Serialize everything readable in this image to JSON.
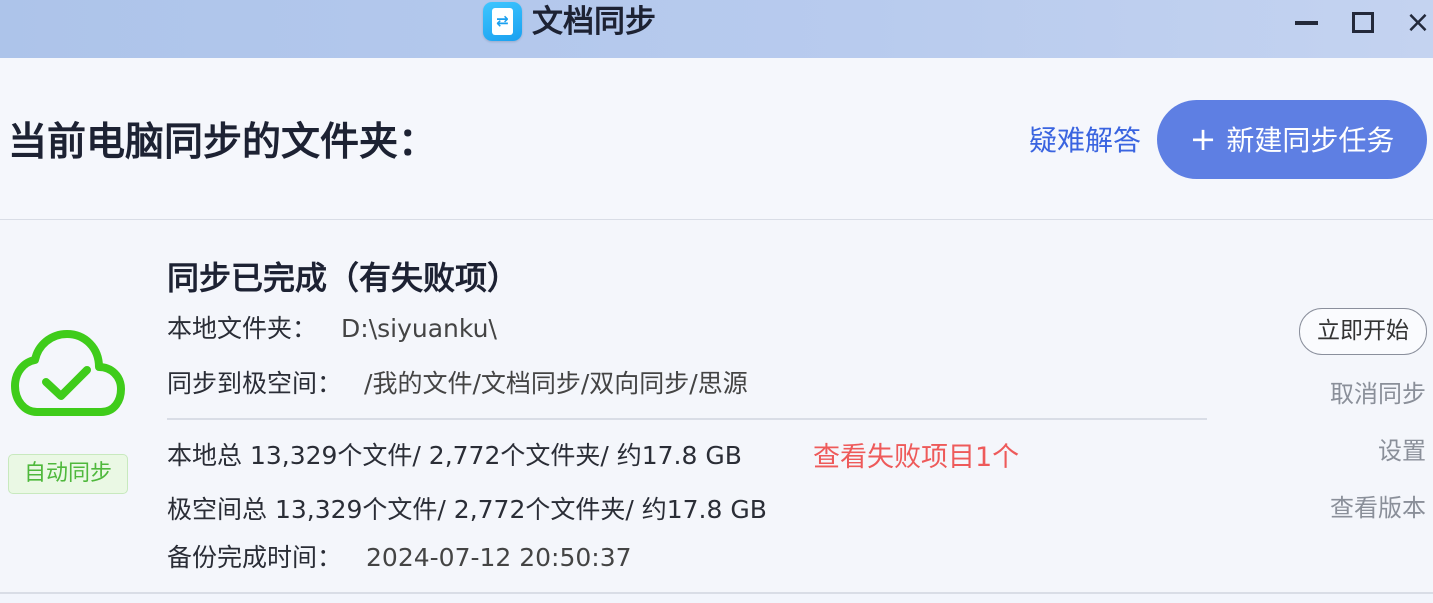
{
  "window": {
    "title": "文档同步",
    "controls": {
      "minimize": "minimize-icon",
      "maximize": "maximize-icon",
      "close": "×"
    }
  },
  "header": {
    "page_title": "当前电脑同步的文件夹：",
    "help_link": "疑难解答",
    "new_task_button": {
      "icon": "plus-icon",
      "plus": "+",
      "label": "新建同步任务"
    }
  },
  "task": {
    "icon": "cloud-check-icon",
    "badge": "自动同步",
    "status_title": "同步已完成（有失败项）",
    "local_folder_label": "本地文件夹：",
    "local_folder_value": "D:\\siyuanku\\",
    "remote_folder_label": "同步到极空间：",
    "remote_folder_value": "/我的文件/文档同步/双向同步/思源",
    "local_total": "本地总 13,329个文件/ 2,772个文件夹/ 约17.8 GB",
    "failed_link": "查看失败项目1个",
    "remote_total": "极空间总 13,329个文件/ 2,772个文件夹/ 约17.8 GB",
    "backup_time_label": "备份完成时间：",
    "backup_time_value": "2024-07-12 20:50:37"
  },
  "actions": {
    "start_now": "立即开始",
    "cancel_sync": "取消同步",
    "settings": "设置",
    "view_versions": "查看版本"
  },
  "colors": {
    "accent_button": "#5e7fe3",
    "link_blue": "#3a64e0",
    "fail_red": "#ee5a5a",
    "success_green": "#4fb83c"
  }
}
